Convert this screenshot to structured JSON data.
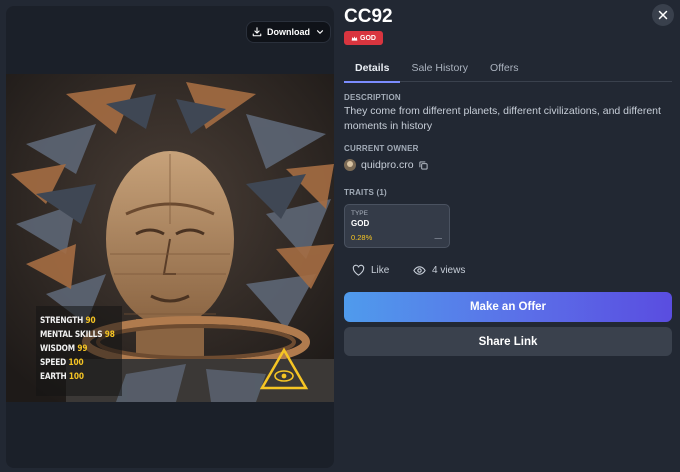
{
  "nft": {
    "title": "CC92",
    "badge": "GOD"
  },
  "toolbar": {
    "download_label": "Download"
  },
  "tabs": [
    {
      "label": "Details",
      "active": true
    },
    {
      "label": "Sale History",
      "active": false
    },
    {
      "label": "Offers",
      "active": false
    }
  ],
  "description": {
    "label": "DESCRIPTION",
    "text": "They come from different planets, different civilizations, and different moments in history"
  },
  "owner": {
    "label": "CURRENT OWNER",
    "name": "quidpro.cro"
  },
  "traits": {
    "label": "TRAITS (1)",
    "items": [
      {
        "type": "TYPE",
        "value": "GOD",
        "rarity": "0.28%",
        "extra": "—"
      }
    ]
  },
  "engagement": {
    "like_label": "Like",
    "views_label": "4 views"
  },
  "actions": {
    "offer_label": "Make an Offer",
    "share_label": "Share Link"
  },
  "artwork_stats": [
    {
      "name": "STRENGTH",
      "value": "90"
    },
    {
      "name": "MENTAL SKILLS",
      "value": "98"
    },
    {
      "name": "WISDOM",
      "value": "99"
    },
    {
      "name": "SPEED",
      "value": "100"
    },
    {
      "name": "EARTH",
      "value": "100"
    }
  ],
  "icons": {
    "download": "download-icon",
    "dropdown": "chevron-down-icon",
    "badge": "crown-icon",
    "close": "close-icon",
    "copy": "copy-icon",
    "like": "heart-icon",
    "views": "eye-icon",
    "emblem": "eye-of-providence-icon"
  },
  "colors": {
    "background": "#222833",
    "badge": "#d9353f",
    "accent": "#7b8cff",
    "rarity": "#f6c524",
    "offer_gradient_start": "#4f9bec",
    "offer_gradient_end": "#5a4de0"
  }
}
